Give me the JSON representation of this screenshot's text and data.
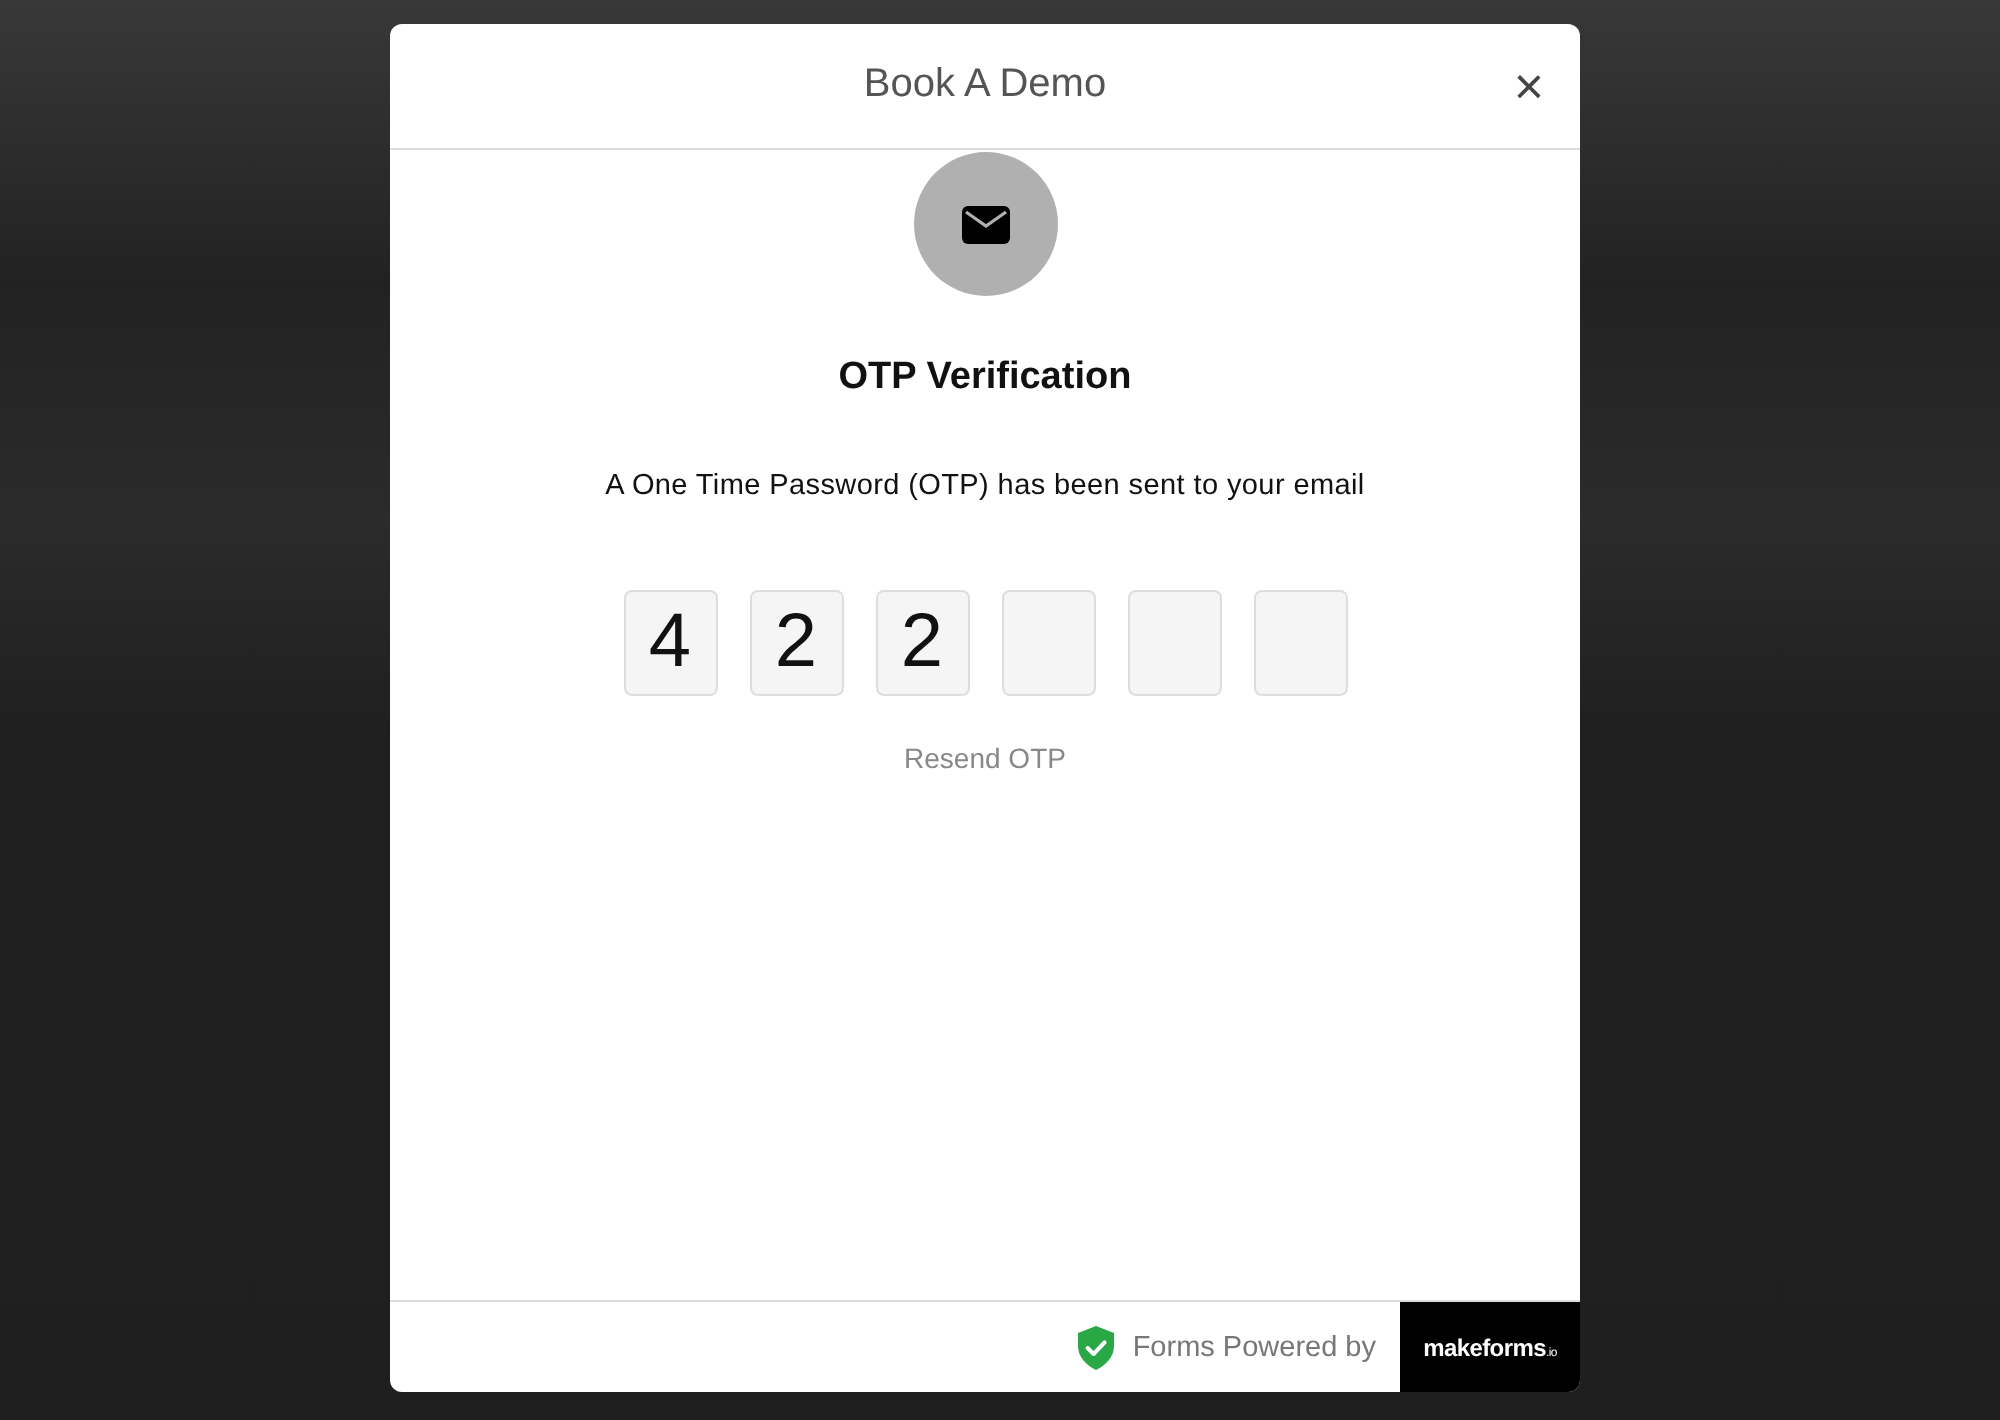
{
  "dialog": {
    "title": "Book A Demo",
    "close": "×"
  },
  "otp": {
    "heading": "OTP Verification",
    "message": "A One Time Password (OTP) has been sent to your email",
    "digits": [
      {
        "kind": "filled",
        "value": "4"
      },
      {
        "kind": "filled",
        "value": "2"
      },
      {
        "kind": "filled",
        "value": "2"
      },
      {
        "kind": "empty"
      },
      {
        "kind": "empty"
      },
      {
        "kind": "empty"
      }
    ],
    "resend": "Resend OTP"
  },
  "footer": {
    "powered_by": "Forms Powered by",
    "brand": "makeforms",
    "brand_suffix": ".io"
  }
}
